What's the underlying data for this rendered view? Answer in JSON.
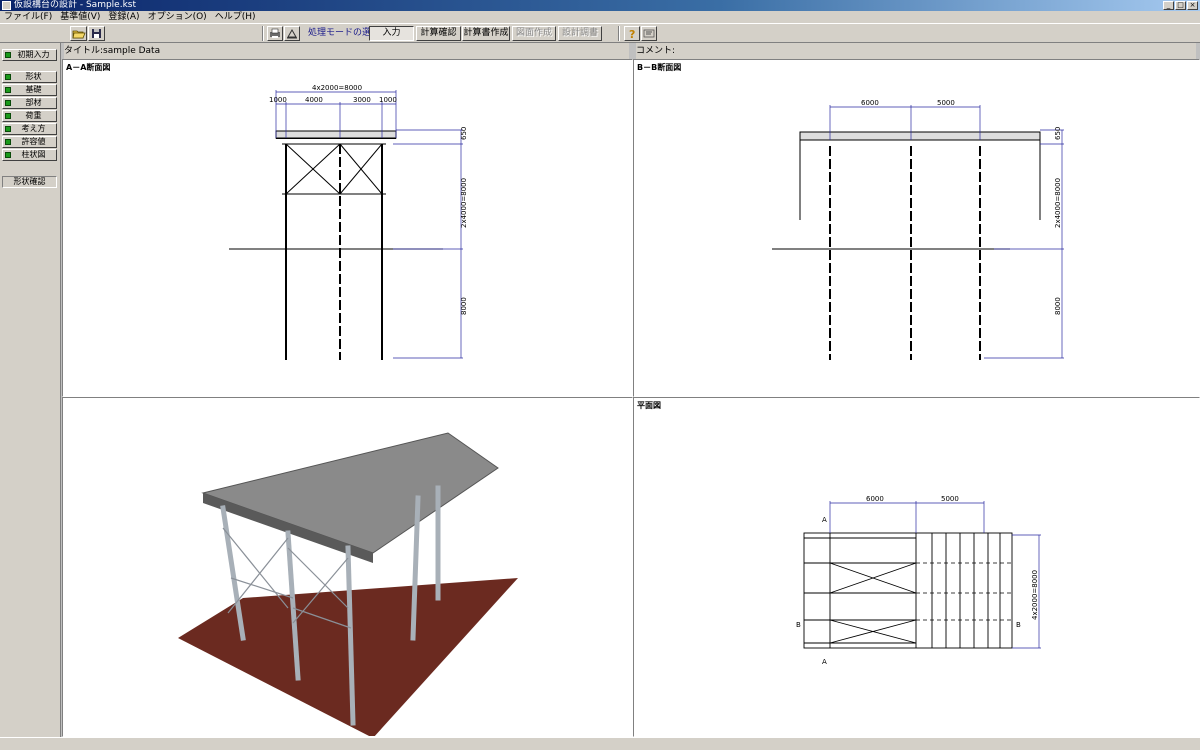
{
  "window": {
    "title": "仮設構台の設計 - Sample.kst"
  },
  "menu": [
    "ファイル(F)",
    "基準値(V)",
    "登録(A)",
    "オプション(O)",
    "ヘルプ(H)"
  ],
  "toolbar": {
    "mode_label": "処理モードの選択",
    "buttons": [
      "入力",
      "計算確認",
      "計算書作成",
      "図面作成",
      "設計調書"
    ]
  },
  "sidebar": {
    "items": [
      "初期入力",
      "形状",
      "基礎",
      "部材",
      "荷重",
      "考え方",
      "許容値",
      "柱状図",
      "形状確認"
    ]
  },
  "header": {
    "title": "タイトル:sample Data",
    "comment": "コメント:"
  },
  "panes": {
    "aa": {
      "title": "A－A断面図",
      "dims": {
        "total": "4x2000=8000",
        "d1": "1000",
        "d2": "4000",
        "d3": "3000",
        "d4": "1000",
        "h_top": "650",
        "h_mid": "2x4000=8000",
        "h_bottom": "8000"
      }
    },
    "bb": {
      "title": "B－B断面図",
      "dims": {
        "s1": "6000",
        "s2": "5000",
        "h_top": "650",
        "h_mid": "2x4000=8000",
        "h_bottom": "8000"
      }
    },
    "plan": {
      "title": "平面図",
      "dims": {
        "s1": "6000",
        "s2": "5000",
        "v": "4x2000=8000",
        "a_top": "A",
        "a_bottom": "A",
        "b_left": "B",
        "b_right": "B"
      }
    }
  },
  "colors": {
    "accent": "#0a246a",
    "dim_line": "#2a2aa0",
    "ground": "#6b2a20"
  }
}
